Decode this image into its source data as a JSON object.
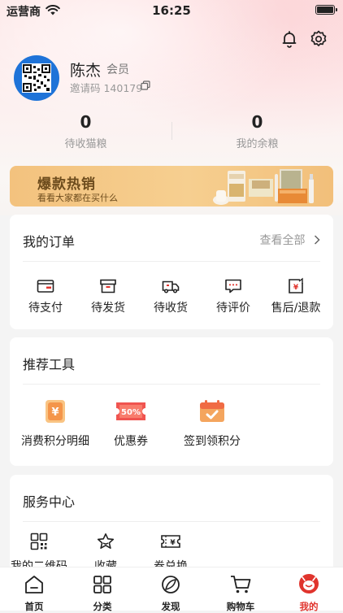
{
  "status_bar": {
    "carrier": "运营商",
    "time": "16:25"
  },
  "profile": {
    "name": "陈杰",
    "level": "会员",
    "invite_code": "邀请码 140179"
  },
  "stats": [
    {
      "value": "0",
      "label": "待收猫粮"
    },
    {
      "value": "0",
      "label": "我的余粮"
    }
  ],
  "banner": {
    "title": "爆款热销",
    "subtitle": "看看大家都在买什么"
  },
  "orders": {
    "title": "我的订单",
    "view_all": "查看全部",
    "items": [
      {
        "label": "待支付",
        "icon": "wallet-icon"
      },
      {
        "label": "待发货",
        "icon": "box-icon"
      },
      {
        "label": "待收货",
        "icon": "truck-icon"
      },
      {
        "label": "待评价",
        "icon": "comment-icon"
      },
      {
        "label": "售后/退款",
        "icon": "refund-icon"
      }
    ]
  },
  "tools": {
    "title": "推荐工具",
    "items": [
      {
        "label": "消费积分明细",
        "icon": "points-coin-icon"
      },
      {
        "label": "优惠券",
        "icon": "coupon-icon",
        "badge": "50%"
      },
      {
        "label": "签到领积分",
        "icon": "checkin-calendar-icon"
      }
    ]
  },
  "services": {
    "title": "服务中心",
    "items": [
      {
        "label": "我的二维码",
        "icon": "qrcode-icon"
      },
      {
        "label": "收藏",
        "icon": "star-icon"
      },
      {
        "label": "卷兑换",
        "icon": "voucher-exchange-icon"
      }
    ]
  },
  "tabbar": [
    {
      "label": "首页",
      "icon": "home-icon"
    },
    {
      "label": "分类",
      "icon": "category-icon"
    },
    {
      "label": "发现",
      "icon": "discover-icon"
    },
    {
      "label": "购物车",
      "icon": "cart-icon"
    },
    {
      "label": "我的",
      "icon": "profile-icon",
      "active": true
    }
  ],
  "colors": {
    "accent": "#e0342d",
    "banner": "#f5c887",
    "banner_text": "#6d4c1d"
  }
}
